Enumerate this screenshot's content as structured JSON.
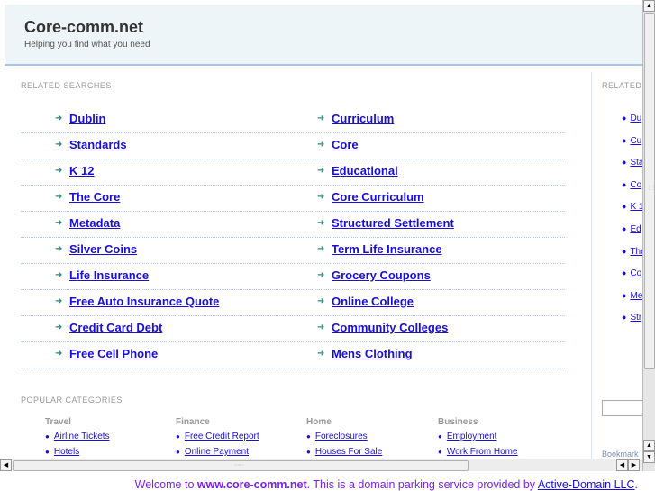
{
  "header": {
    "title": "Core-comm.net",
    "tagline": "Helping you find what you need"
  },
  "related": {
    "heading": "RELATED SEARCHES",
    "left": [
      "Dublin",
      "Standards",
      "K 12",
      "The Core",
      "Metadata",
      "Silver Coins",
      "Life Insurance",
      "Free Auto Insurance Quote",
      "Credit Card Debt",
      "Free Cell Phone"
    ],
    "right": [
      "Curriculum",
      "Core",
      "Educational",
      "Core Curriculum",
      "Structured Settlement",
      "Term Life Insurance",
      "Grocery Coupons",
      "Online College",
      "Community Colleges",
      "Mens Clothing"
    ]
  },
  "sidebar": {
    "heading": "RELATED",
    "items": [
      "Du",
      "Cu",
      "Sta",
      "Co",
      "K 1",
      "Ed",
      "The",
      "Co",
      "Me",
      "Str"
    ],
    "bookmark": "Bookmark"
  },
  "popular": {
    "heading": "POPULAR CATEGORIES",
    "categories": [
      {
        "name": "Travel",
        "items": [
          "Airline Tickets",
          "Hotels"
        ]
      },
      {
        "name": "Finance",
        "items": [
          "Free Credit Report",
          "Online Payment"
        ]
      },
      {
        "name": "Home",
        "items": [
          "Foreclosures",
          "Houses For Sale"
        ]
      },
      {
        "name": "Business",
        "items": [
          "Employment",
          "Work From Home"
        ]
      }
    ]
  },
  "footer": {
    "prefix": "Welcome to ",
    "domain": "www.core-comm.net",
    "middle": ". This is a domain parking service provided by ",
    "provider": "Active-Domain LLC",
    "suffix": "."
  }
}
